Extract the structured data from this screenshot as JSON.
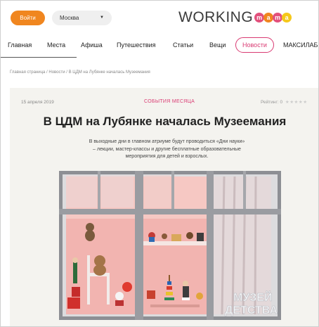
{
  "header": {
    "login_label": "Войти",
    "city": "Москва",
    "logo_text": "WORKING",
    "logo_letters": [
      "m",
      "a",
      "m",
      "a"
    ]
  },
  "nav": {
    "items": [
      "Главная",
      "Места",
      "Афиша",
      "Путешествия",
      "Статьи",
      "Вещи",
      "Новости",
      "МАКСИЛАБ"
    ],
    "active": "Новости"
  },
  "breadcrumb": "Главная страница / Новости / В ЦДМ на Лубянке началась Музеемания",
  "article": {
    "date": "15 апреля 2019",
    "category": "СОБЫТИЯ МЕСЯЦА",
    "rating_label": "Рейтинг: 0",
    "rating_stars": "★★★★★",
    "rating_value": 0,
    "title": "В ЦДМ на Лубянке началась Музеемания",
    "lead": "В выходные дни в главном атриуме будут проводиться «Дни науки» – лекции, мастер-классы и другие бесплатные образовательные мероприятия для детей и взрослых.",
    "photo_sign": [
      "МУЗЕЙ",
      "ДЕТСТВА"
    ]
  },
  "colors": {
    "accent_orange": "#f0861f",
    "accent_pink": "#d93a72",
    "logo_yellow": "#f5c81b",
    "card_bg": "#f4f3ef"
  }
}
